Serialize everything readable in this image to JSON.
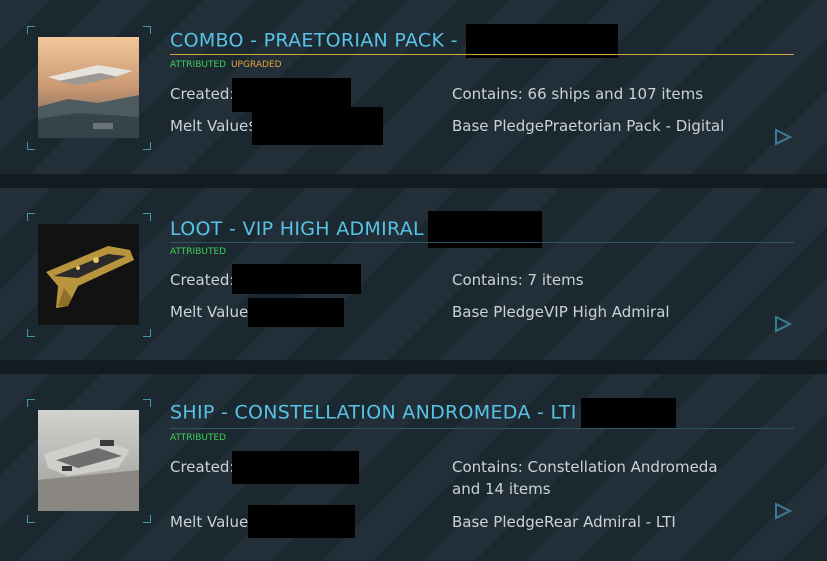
{
  "pledges": [
    {
      "title": "COMBO - PRAETORIAN PACK -",
      "tags": {
        "attributed": "ATTRIBUTED",
        "upgraded": "UPGRADED"
      },
      "created_label": "Created:",
      "contains": "Contains: 66 ships and 107 items",
      "melt_label": "Melt Value$",
      "base_pledge_label": "Base Pledge",
      "base_pledge_value": "Praetorian Pack - Digital",
      "thumbnail_icon": "ship-over-city-thumbnail",
      "accent_rule_color": "#d9a53a"
    },
    {
      "title": "LOOT - VIP HIGH ADMIRAL",
      "tags": {
        "attributed": "ATTRIBUTED"
      },
      "created_label": "Created:",
      "contains": "Contains: 7 items",
      "melt_label": "Melt Value$",
      "base_pledge_label": "Base Pledge",
      "base_pledge_value": "VIP High Admiral",
      "thumbnail_icon": "gold-pistol-thumbnail",
      "accent_rule_color": "#2e5566"
    },
    {
      "title": "SHIP - CONSTELLATION ANDROMEDA - LTI",
      "tags": {
        "attributed": "ATTRIBUTED"
      },
      "created_label": "Created:",
      "contains_line1": "Contains: Constellation Andromeda",
      "contains_line2": "and 14 items",
      "melt_label": "Melt Value$",
      "base_pledge_label": "Base Pledge",
      "base_pledge_value": "Rear Admiral - LTI",
      "thumbnail_icon": "constellation-ship-thumbnail",
      "accent_rule_color": "#2e5566"
    }
  ],
  "colors": {
    "title": "#56c3e6",
    "attributed": "#3ed05a",
    "upgraded": "#e0a33a",
    "text": "#c9d3d8"
  }
}
